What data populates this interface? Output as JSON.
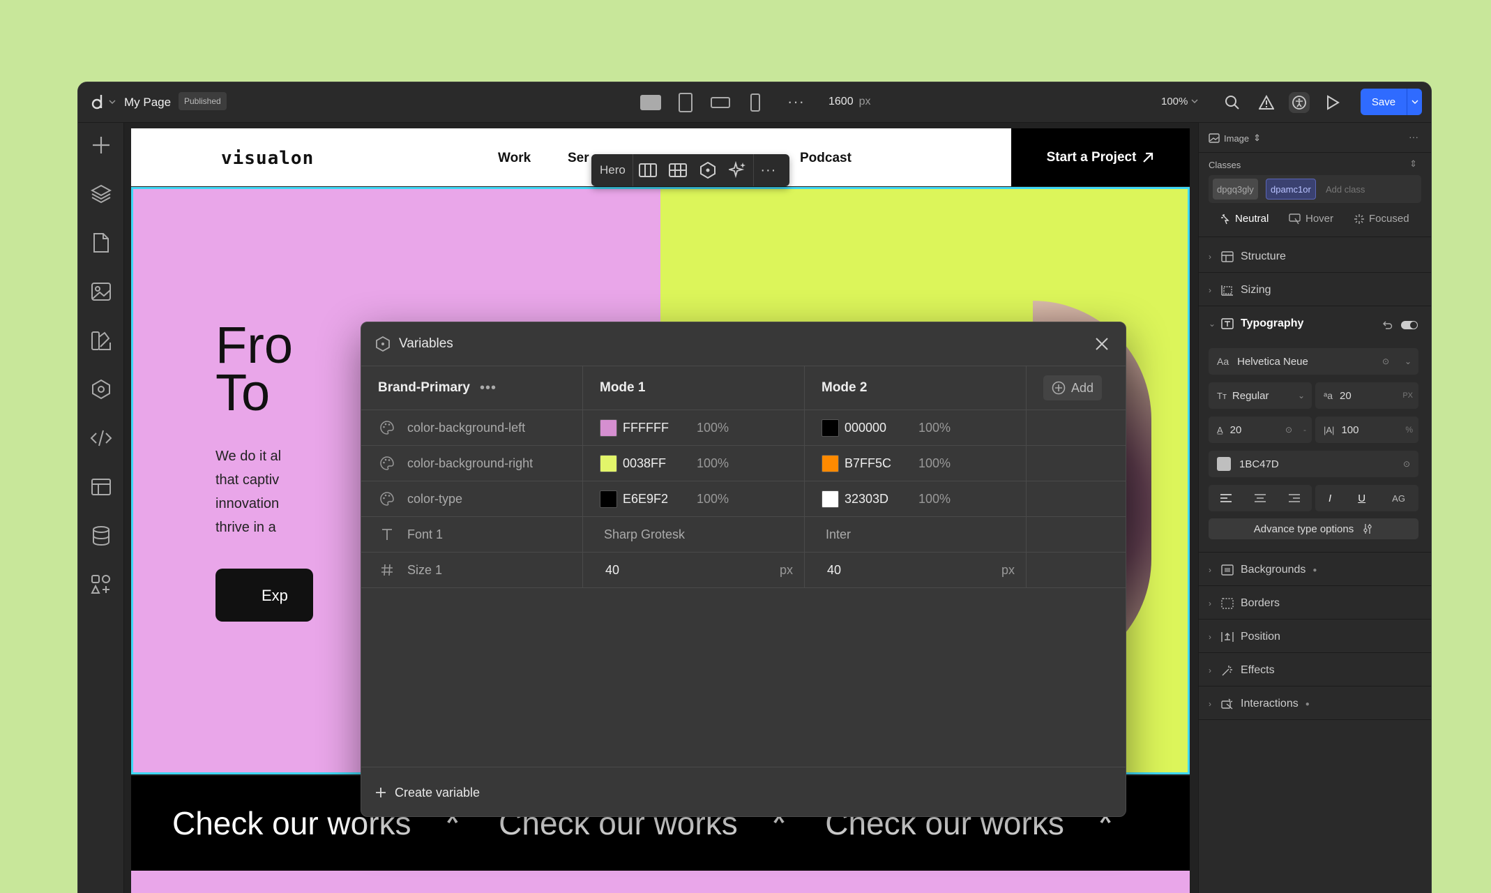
{
  "topbar": {
    "page_name": "My Page",
    "status_badge": "Published",
    "width_value": "1600",
    "width_unit": "px",
    "zoom": "100%",
    "save_label": "Save"
  },
  "site": {
    "logo": "visualon",
    "nav": [
      "Work",
      "Ser",
      "Podcast"
    ],
    "cta": "Start a Project",
    "hero_title": "Fro\nTo",
    "hero_body": "We do it al\nthat captiv\ninnovation\nthrive in a",
    "hero_button": "Exp",
    "marquee": [
      "Check our works",
      "Check our works",
      "Check our works"
    ],
    "marquee_star": "*"
  },
  "float_toolbar": {
    "label": "Hero"
  },
  "variables_modal": {
    "title": "Variables",
    "collection": "Brand-Primary",
    "modes": [
      "Mode 1",
      "Mode 2"
    ],
    "add_label": "Add",
    "rows": [
      {
        "icon": "palette-icon",
        "name": "color-background-left",
        "m1": {
          "type": "color",
          "swatch": "#d58fd0",
          "hex": "FFFFFF",
          "pct": "100%"
        },
        "m2": {
          "type": "color",
          "swatch": "#000000",
          "hex": "000000",
          "pct": "100%"
        }
      },
      {
        "icon": "palette-icon",
        "name": "color-background-right",
        "m1": {
          "type": "color",
          "swatch": "#e2f56a",
          "hex": "0038FF",
          "pct": "100%"
        },
        "m2": {
          "type": "color",
          "swatch": "#ff8a00",
          "hex": "B7FF5C",
          "pct": "100%"
        }
      },
      {
        "icon": "palette-icon",
        "name": "color-type",
        "m1": {
          "type": "color",
          "swatch": "#000000",
          "hex": "E6E9F2",
          "pct": "100%"
        },
        "m2": {
          "type": "color",
          "swatch": "#ffffff",
          "hex": "32303D",
          "pct": "100%"
        }
      },
      {
        "icon": "text-t-icon",
        "name": "Font 1",
        "m1": {
          "type": "text",
          "value": "Sharp Grotesk"
        },
        "m2": {
          "type": "text",
          "value": "Inter"
        }
      },
      {
        "icon": "hash-icon",
        "name": "Size 1",
        "m1": {
          "type": "number",
          "value": "40",
          "unit": "px"
        },
        "m2": {
          "type": "number",
          "value": "40",
          "unit": "px"
        }
      }
    ],
    "create_label": "Create variable"
  },
  "right_panel": {
    "element_type": "Image",
    "classes_label": "Classes",
    "classes": [
      "dpgq3gly",
      "dpamc1or"
    ],
    "add_class_placeholder": "Add class",
    "states": [
      "Neutral",
      "Hover",
      "Focused"
    ],
    "sections_top": [
      "Structure",
      "Sizing"
    ],
    "typography": {
      "label": "Typography",
      "font_family": "Helvetica Neue",
      "weight": "Regular",
      "size": "20",
      "size_unit": "PX",
      "line_height": "20",
      "letter_spacing": "100",
      "letter_spacing_unit": "%",
      "color_hex": "1BC47D",
      "advanced_label": "Advance type options",
      "style_caps": "AG"
    },
    "sections_bottom": [
      "Backgrounds",
      "Borders",
      "Position",
      "Effects",
      "Interactions"
    ]
  }
}
